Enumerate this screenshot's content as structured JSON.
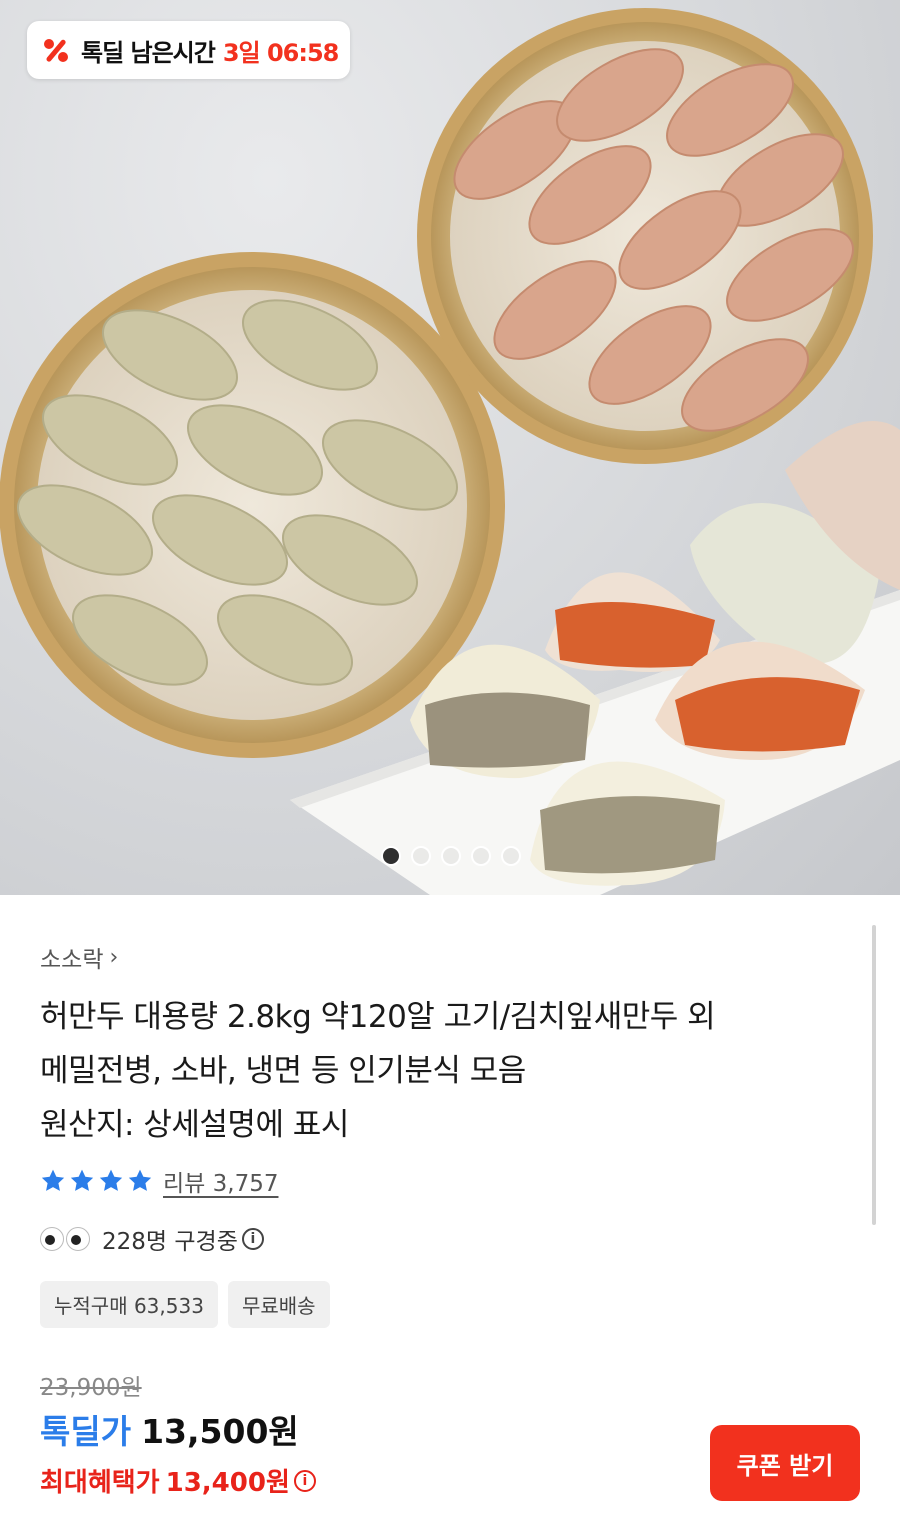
{
  "deal_timer": {
    "label": "톡딜 남은시간",
    "time": "3일 06:58",
    "icon": "percent-icon",
    "accent_color": "#f2311e"
  },
  "carousel": {
    "total": 5,
    "active_index": 0
  },
  "product": {
    "seller": "소소락",
    "title_lines": [
      "허만두 대용량 2.8kg 약120알 고기/김치잎새만두 외",
      "메밀전병, 소바, 냉면 등 인기분식 모음",
      "원산지: 상세설명에 표시"
    ],
    "rating_stars": 4,
    "review_label": "리뷰 3,757",
    "viewers_label": "228명 구경중",
    "chips": [
      "누적구매 63,533",
      "무료배송"
    ]
  },
  "price": {
    "original": "23,900원",
    "deal_label": "톡딜가",
    "deal_price": "13,500원",
    "max_label": "최대혜택가",
    "max_price": "13,400원"
  },
  "coupon_button": {
    "label": "쿠폰 받기",
    "color": "#f2311e"
  },
  "colors": {
    "deal_blue": "#2b7de9",
    "max_red": "#e8231a",
    "star_blue": "#2b7de9"
  }
}
